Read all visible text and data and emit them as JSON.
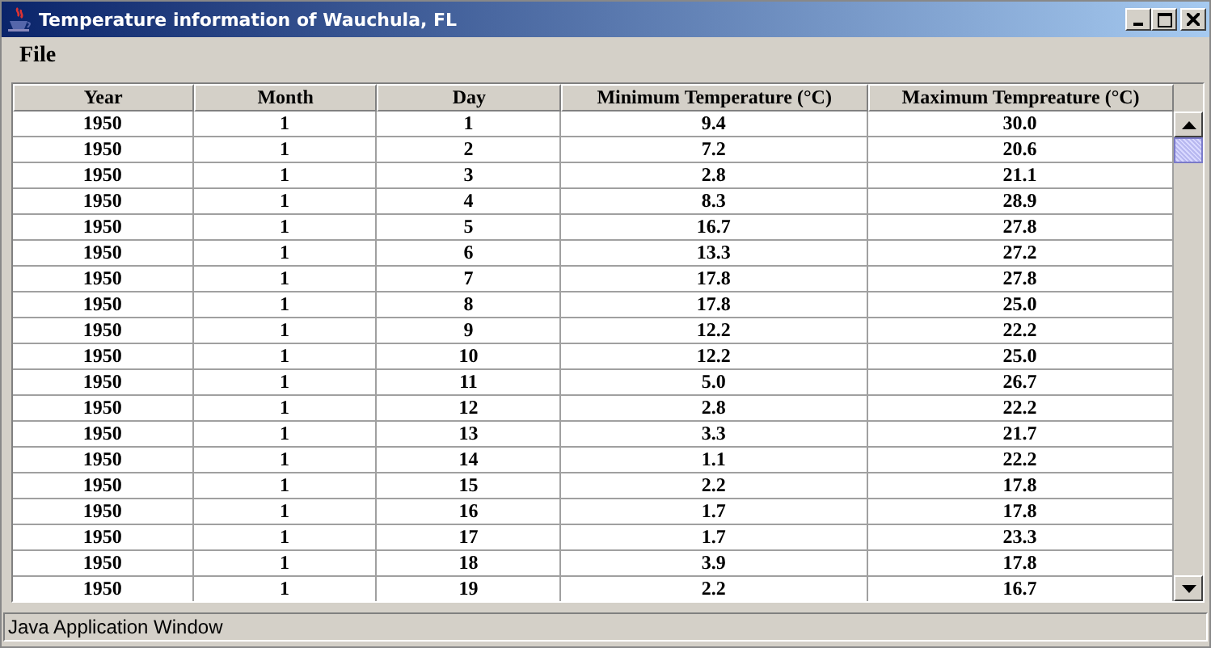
{
  "window": {
    "title": "Temperature information of Wauchula, FL"
  },
  "menu": [
    "File"
  ],
  "table": {
    "columns": [
      "Year",
      "Month",
      "Day",
      "Minimum Temperature (°C)",
      "Maximum Tempreature (°C)"
    ],
    "rows": [
      [
        "1950",
        "1",
        "1",
        "9.4",
        "30.0"
      ],
      [
        "1950",
        "1",
        "2",
        "7.2",
        "20.6"
      ],
      [
        "1950",
        "1",
        "3",
        "2.8",
        "21.1"
      ],
      [
        "1950",
        "1",
        "4",
        "8.3",
        "28.9"
      ],
      [
        "1950",
        "1",
        "5",
        "16.7",
        "27.8"
      ],
      [
        "1950",
        "1",
        "6",
        "13.3",
        "27.2"
      ],
      [
        "1950",
        "1",
        "7",
        "17.8",
        "27.8"
      ],
      [
        "1950",
        "1",
        "8",
        "17.8",
        "25.0"
      ],
      [
        "1950",
        "1",
        "9",
        "12.2",
        "22.2"
      ],
      [
        "1950",
        "1",
        "10",
        "12.2",
        "25.0"
      ],
      [
        "1950",
        "1",
        "11",
        "5.0",
        "26.7"
      ],
      [
        "1950",
        "1",
        "12",
        "2.8",
        "22.2"
      ],
      [
        "1950",
        "1",
        "13",
        "3.3",
        "21.7"
      ],
      [
        "1950",
        "1",
        "14",
        "1.1",
        "22.2"
      ],
      [
        "1950",
        "1",
        "15",
        "2.2",
        "17.8"
      ],
      [
        "1950",
        "1",
        "16",
        "1.7",
        "17.8"
      ],
      [
        "1950",
        "1",
        "17",
        "1.7",
        "23.3"
      ],
      [
        "1950",
        "1",
        "18",
        "3.9",
        "17.8"
      ],
      [
        "1950",
        "1",
        "19",
        "2.2",
        "16.7"
      ]
    ]
  },
  "status_bar": "Java Application Window"
}
